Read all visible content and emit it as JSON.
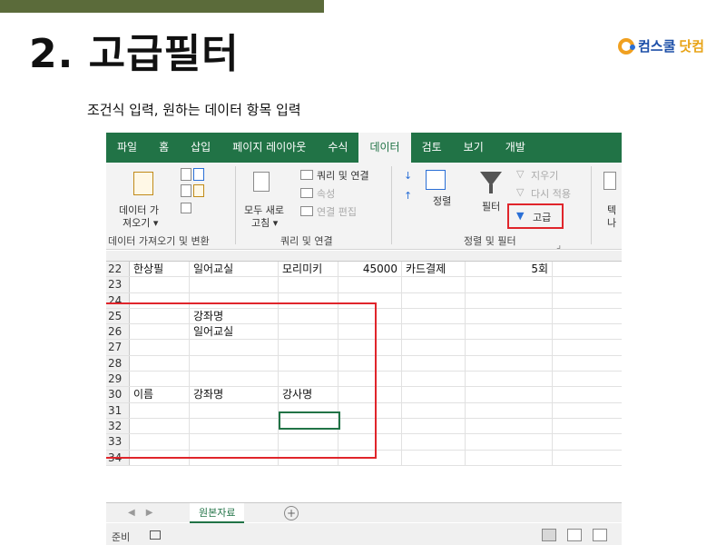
{
  "slide": {
    "title": "2. 고급필터",
    "subtitle": "조건식 입력, 원하는 데이터 항목 입력",
    "brand_part1": "컴스쿨",
    "brand_part2": "닷컴"
  },
  "excel": {
    "tabs": [
      "파일",
      "홈",
      "삽입",
      "페이지 레이아웃",
      "수식",
      "데이터",
      "검토",
      "보기",
      "개발"
    ],
    "active_tab": "데이터",
    "ribbon": {
      "get_data": "데이터 가",
      "get_data2": "져오기 ▾",
      "group_get": "데이터 가져오기 및 변환",
      "refresh_all": "모두 새로",
      "refresh_all2": "고침 ▾",
      "queries_connections": "쿼리 및 연결",
      "properties": "속성",
      "edit_links": "연결 편집",
      "group_queries": "쿼리 및 연결",
      "sort": "정렬",
      "filter": "필터",
      "clear": "지우기",
      "reapply": "다시 적용",
      "advanced": "고급",
      "group_sort_filter": "정렬 및 필터",
      "partial1": "텍",
      "partial2": "나"
    },
    "rows": [
      {
        "num": "22",
        "a": "한상필",
        "b": "일어교실",
        "c": "모리미키",
        "d": "45000",
        "e": "카드결제",
        "f": "5회"
      },
      {
        "num": "23",
        "a": "",
        "b": "",
        "c": "",
        "d": "",
        "e": "",
        "f": ""
      },
      {
        "num": "24",
        "a": "",
        "b": "",
        "c": "",
        "d": "",
        "e": "",
        "f": ""
      },
      {
        "num": "25",
        "a": "",
        "b": "강좌명",
        "c": "",
        "d": "",
        "e": "",
        "f": ""
      },
      {
        "num": "26",
        "a": "",
        "b": "일어교실",
        "c": "",
        "d": "",
        "e": "",
        "f": ""
      },
      {
        "num": "27",
        "a": "",
        "b": "",
        "c": "",
        "d": "",
        "e": "",
        "f": ""
      },
      {
        "num": "28",
        "a": "",
        "b": "",
        "c": "",
        "d": "",
        "e": "",
        "f": ""
      },
      {
        "num": "29",
        "a": "",
        "b": "",
        "c": "",
        "d": "",
        "e": "",
        "f": ""
      },
      {
        "num": "30",
        "a": "이름",
        "b": "강좌명",
        "c": "강사명",
        "d": "",
        "e": "",
        "f": ""
      },
      {
        "num": "31",
        "a": "",
        "b": "",
        "c": "",
        "d": "",
        "e": "",
        "f": ""
      },
      {
        "num": "32",
        "a": "",
        "b": "",
        "c": "",
        "d": "",
        "e": "",
        "f": ""
      },
      {
        "num": "33",
        "a": "",
        "b": "",
        "c": "",
        "d": "",
        "e": "",
        "f": ""
      },
      {
        "num": "34",
        "a": "",
        "b": "",
        "c": "",
        "d": "",
        "e": "",
        "f": ""
      }
    ],
    "sheet_tab": "원본자료",
    "add_sheet": "+",
    "status": "준비",
    "colors": {
      "excel_green": "#217346",
      "highlight_red": "#e0252b"
    }
  }
}
